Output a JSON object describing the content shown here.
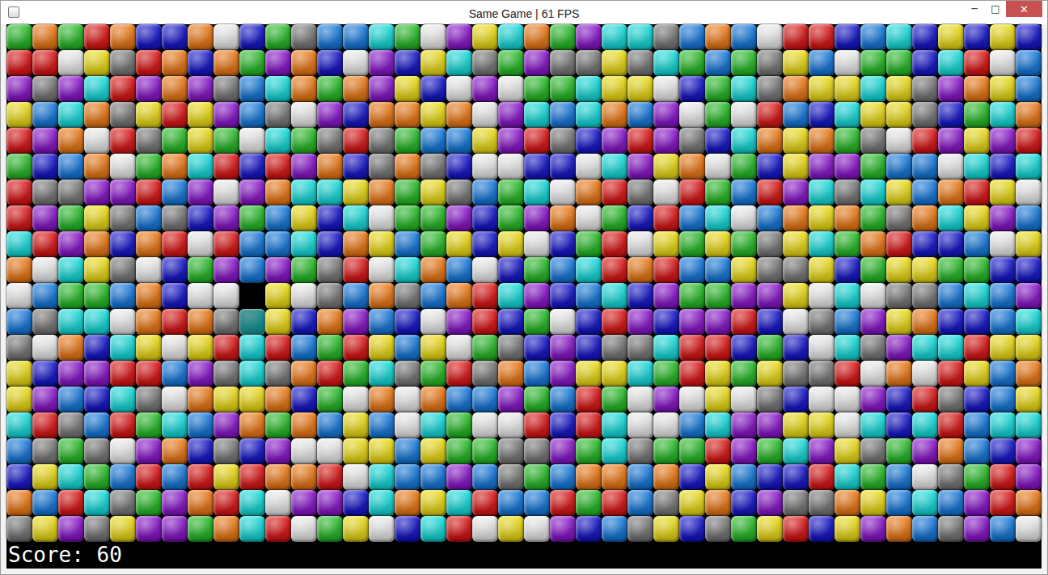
{
  "window": {
    "title": "Same Game | 61 FPS",
    "controls": [
      {
        "label": "─"
      },
      {
        "label": "□"
      },
      {
        "label": "✕"
      }
    ]
  },
  "board": {
    "rows": [
      [
        "#2b2",
        "#e71",
        "#2b2",
        "#d11",
        "#e71",
        "#11c",
        "#11c",
        "#e71",
        "#eee",
        "#11c",
        "#2b2",
        "#777",
        "#17d",
        "#17d",
        "#1dd",
        "#2b2",
        "#eee",
        "#81c",
        "#ed1",
        "#1dd",
        "#e71",
        "#2b2",
        "#81c",
        "#1dd",
        "#1dd",
        "#777",
        "#17d",
        "#e71",
        "#17d",
        "#eee",
        "#d11",
        "#d11",
        "#11c",
        "#17d",
        "#1dd",
        "#11c",
        "#ed1",
        "#11c",
        "#ed1",
        "#11c"
      ],
      [
        "#d11",
        "#d11",
        "#eee",
        "#ed1",
        "#777",
        "#d11",
        "#e71",
        "#11c",
        "#e71",
        "#2b2",
        "#81c",
        "#e71",
        "#11c",
        "#eee",
        "#81c",
        "#11c",
        "#ed1",
        "#1dd",
        "#777",
        "#2b2",
        "#81c",
        "#777",
        "#777",
        "#ed1",
        "#777",
        "#1dd",
        "#2b2",
        "#17d",
        "#2b2",
        "#777",
        "#ed1",
        "#17d",
        "#eee",
        "#2b2",
        "#2b2",
        "#11c",
        "#1dd",
        "#d11",
        "#eee",
        "#17d"
      ],
      [
        "#81c",
        "#777",
        "#81c",
        "#1dd",
        "#d11",
        "#81c",
        "#e71",
        "#81c",
        "#777",
        "#17d",
        "#1dd",
        "#e71",
        "#2b2",
        "#e71",
        "#81c",
        "#ed1",
        "#11c",
        "#eee",
        "#81c",
        "#eee",
        "#2b2",
        "#2b2",
        "#1dd",
        "#ed1",
        "#ed1",
        "#eee",
        "#11c",
        "#2b2",
        "#1dd",
        "#777",
        "#e71",
        "#ed1",
        "#ed1",
        "#1dd",
        "#ed1",
        "#777",
        "#81c",
        "#e71",
        "#ed1",
        "#17d"
      ],
      [
        "#ed1",
        "#17d",
        "#1dd",
        "#e71",
        "#777",
        "#ed1",
        "#d11",
        "#ed1",
        "#81c",
        "#17d",
        "#777",
        "#eee",
        "#81c",
        "#11c",
        "#e71",
        "#e71",
        "#ed1",
        "#e71",
        "#eee",
        "#81c",
        "#1dd",
        "#17d",
        "#1dd",
        "#e71",
        "#17d",
        "#81c",
        "#eee",
        "#2b2",
        "#eee",
        "#d11",
        "#17d",
        "#11c",
        "#1dd",
        "#ed1",
        "#ed1",
        "#777",
        "#11c",
        "#2b2",
        "#1dd",
        "#e71"
      ],
      [
        "#d11",
        "#81c",
        "#e71",
        "#eee",
        "#d11",
        "#777",
        "#2b2",
        "#ed1",
        "#2b2",
        "#eee",
        "#1dd",
        "#2b2",
        "#777",
        "#d11",
        "#777",
        "#2b2",
        "#17d",
        "#17d",
        "#ed1",
        "#81c",
        "#d11",
        "#777",
        "#11c",
        "#81c",
        "#d11",
        "#81c",
        "#777",
        "#11c",
        "#1dd",
        "#e71",
        "#ed1",
        "#e71",
        "#2b2",
        "#777",
        "#eee",
        "#d11",
        "#81c",
        "#ed1",
        "#81c",
        "#d11"
      ],
      [
        "#2b2",
        "#11c",
        "#17d",
        "#e71",
        "#eee",
        "#2b2",
        "#e71",
        "#1dd",
        "#d11",
        "#11c",
        "#d11",
        "#81c",
        "#e71",
        "#11c",
        "#777",
        "#e71",
        "#777",
        "#11c",
        "#eee",
        "#eee",
        "#11c",
        "#11c",
        "#eee",
        "#1dd",
        "#81c",
        "#ed1",
        "#e71",
        "#eee",
        "#2b2",
        "#11c",
        "#ed1",
        "#81c",
        "#81c",
        "#2b2",
        "#17d",
        "#17d",
        "#eee",
        "#1dd",
        "#11c",
        "#1dd"
      ],
      [
        "#d11",
        "#777",
        "#777",
        "#81c",
        "#81c",
        "#d11",
        "#17d",
        "#81c",
        "#eee",
        "#81c",
        "#e71",
        "#1dd",
        "#1dd",
        "#ed1",
        "#e71",
        "#2b2",
        "#ed1",
        "#777",
        "#17d",
        "#2b2",
        "#1dd",
        "#eee",
        "#e71",
        "#d11",
        "#777",
        "#eee",
        "#d11",
        "#2b2",
        "#17d",
        "#d11",
        "#81c",
        "#1dd",
        "#777",
        "#1dd",
        "#ed1",
        "#17d",
        "#e71",
        "#d11",
        "#ed1",
        "#eee"
      ],
      [
        "#d11",
        "#81c",
        "#2b2",
        "#ed1",
        "#777",
        "#17d",
        "#777",
        "#11c",
        "#81c",
        "#2b2",
        "#17d",
        "#ed1",
        "#11c",
        "#1dd",
        "#eee",
        "#2b2",
        "#2b2",
        "#81c",
        "#11c",
        "#2b2",
        "#81c",
        "#e71",
        "#eee",
        "#2b2",
        "#11c",
        "#d11",
        "#17d",
        "#1dd",
        "#eee",
        "#17d",
        "#e71",
        "#ed1",
        "#e71",
        "#2b2",
        "#777",
        "#e71",
        "#1dd",
        "#ed1",
        "#81c",
        "#17d"
      ],
      [
        "#1dd",
        "#d11",
        "#81c",
        "#e71",
        "#11c",
        "#e71",
        "#d11",
        "#eee",
        "#d11",
        "#17d",
        "#17d",
        "#1dd",
        "#11c",
        "#e71",
        "#ed1",
        "#17d",
        "#2b2",
        "#ed1",
        "#11c",
        "#ed1",
        "#eee",
        "#11c",
        "#2b2",
        "#d11",
        "#eee",
        "#ed1",
        "#2b2",
        "#ed1",
        "#2b2",
        "#777",
        "#ed1",
        "#1dd",
        "#2b2",
        "#e71",
        "#d11",
        "#11c",
        "#11c",
        "#17d",
        "#eee",
        "#ed1"
      ],
      [
        "#e71",
        "#eee",
        "#1dd",
        "#ed1",
        "#777",
        "#eee",
        "#11c",
        "#2b2",
        "#81c",
        "#17d",
        "#81c",
        "#2b2",
        "#777",
        "#d11",
        "#eee",
        "#1dd",
        "#e71",
        "#17d",
        "#eee",
        "#11c",
        "#2b2",
        "#17d",
        "#1dd",
        "#d11",
        "#e71",
        "#d11",
        "#17d",
        "#17d",
        "#ed1",
        "#777",
        "#777",
        "#ed1",
        "#11c",
        "#2b2",
        "#ed1",
        "#ed1",
        "#2b2",
        "#2b2",
        "#11c",
        "#11c"
      ],
      [
        "#eee",
        "#17d",
        "#2b2",
        "#2b2",
        "#17d",
        "#e71",
        "#11c",
        "#eee",
        "#eee",
        null,
        "#ed1",
        "#eee",
        "#777",
        "#17d",
        "#e71",
        "#777",
        "#17d",
        "#e71",
        "#d11",
        "#1dd",
        "#81c",
        "#11c",
        "#17d",
        "#1dd",
        "#11c",
        "#81c",
        "#2b2",
        "#2b2",
        "#81c",
        "#81c",
        "#ed1",
        "#eee",
        "#1dd",
        "#eee",
        "#777",
        "#777",
        "#17d",
        "#1dd",
        "#17d",
        "#81c"
      ],
      [
        "#17d",
        "#777",
        "#1dd",
        "#1dd",
        "#eee",
        "#e71",
        "#d11",
        "#e71",
        "#777",
        {
          "color": "#1dd",
          "selected": true
        },
        "#ed1",
        "#11c",
        "#e71",
        "#81c",
        "#17d",
        "#11c",
        "#eee",
        "#81c",
        "#d11",
        "#11c",
        "#2b2",
        "#eee",
        "#11c",
        "#d11",
        "#81c",
        "#11c",
        "#81c",
        "#81c",
        "#d11",
        "#11c",
        "#eee",
        "#777",
        "#17d",
        "#81c",
        "#ed1",
        "#e71",
        "#11c",
        "#11c",
        "#17d",
        "#1dd"
      ],
      [
        "#777",
        "#eee",
        "#e71",
        "#11c",
        "#1dd",
        "#ed1",
        "#eee",
        "#ed1",
        "#d11",
        "#1dd",
        "#d11",
        "#17d",
        "#2b2",
        "#d11",
        "#ed1",
        "#17d",
        "#ed1",
        "#eee",
        "#2b2",
        "#777",
        "#11c",
        "#81c",
        "#11c",
        "#777",
        "#777",
        "#1dd",
        "#d11",
        "#d11",
        "#11c",
        "#2b2",
        "#11c",
        "#eee",
        "#1dd",
        "#777",
        "#81c",
        "#1dd",
        "#1dd",
        "#d11",
        "#ed1",
        "#ed1"
      ],
      [
        "#ed1",
        "#11c",
        "#81c",
        "#81c",
        "#d11",
        "#d11",
        "#17d",
        "#81c",
        "#777",
        "#1dd",
        "#777",
        "#e71",
        "#d11",
        "#2b2",
        "#1dd",
        "#777",
        "#2b2",
        "#d11",
        "#777",
        "#e71",
        "#17d",
        "#81c",
        "#ed1",
        "#ed1",
        "#1dd",
        "#2b2",
        "#d11",
        "#ed1",
        "#2b2",
        "#ed1",
        "#777",
        "#777",
        "#d11",
        "#eee",
        "#e71",
        "#eee",
        "#d11",
        "#ed1",
        "#17d",
        "#e71"
      ],
      [
        "#ed1",
        "#81c",
        "#17d",
        "#11c",
        "#1dd",
        "#777",
        "#eee",
        "#e71",
        "#ed1",
        "#ed1",
        "#e71",
        "#11c",
        "#2b2",
        "#eee",
        "#e71",
        "#eee",
        "#e71",
        "#17d",
        "#17d",
        "#81c",
        "#2b2",
        "#17d",
        "#d11",
        "#2b2",
        "#eee",
        "#81c",
        "#eee",
        "#ed1",
        "#eee",
        "#777",
        "#11c",
        "#eee",
        "#eee",
        "#81c",
        "#11c",
        "#d11",
        "#777",
        "#11c",
        "#17d",
        "#ed1"
      ],
      [
        "#1dd",
        "#d11",
        "#777",
        "#17d",
        "#d11",
        "#2b2",
        "#1dd",
        "#17d",
        "#81c",
        "#e71",
        "#2b2",
        "#e71",
        "#17d",
        "#ed1",
        "#17d",
        "#eee",
        "#1dd",
        "#2b2",
        "#eee",
        "#eee",
        "#d11",
        "#11c",
        "#d11",
        "#1dd",
        "#eee",
        "#eee",
        "#17d",
        "#1dd",
        "#81c",
        "#81c",
        "#ed1",
        "#ed1",
        "#eee",
        "#1dd",
        "#11c",
        "#1dd",
        "#d11",
        "#17d",
        "#1dd",
        "#1dd"
      ],
      [
        "#17d",
        "#777",
        "#2b2",
        "#777",
        "#eee",
        "#81c",
        "#e71",
        "#11c",
        "#777",
        "#11c",
        "#81c",
        "#eee",
        "#eee",
        "#ed1",
        "#ed1",
        "#17d",
        "#ed1",
        "#2b2",
        "#2b2",
        "#777",
        "#777",
        "#81c",
        "#2b2",
        "#1dd",
        "#777",
        "#2b2",
        "#2b2",
        "#d11",
        "#81c",
        "#2b2",
        "#1dd",
        "#81c",
        "#ed1",
        "#777",
        "#2b2",
        "#81c",
        "#e71",
        "#17d",
        "#11c",
        "#81c"
      ],
      [
        "#11c",
        "#ed1",
        "#1dd",
        "#2b2",
        "#17d",
        "#d11",
        "#17d",
        "#d11",
        "#ed1",
        "#d11",
        "#e71",
        "#e71",
        "#d11",
        "#eee",
        "#1dd",
        "#17d",
        "#17d",
        "#81c",
        "#17d",
        "#777",
        "#2b2",
        "#17d",
        "#e71",
        "#e71",
        "#17d",
        "#e71",
        "#11c",
        "#ed1",
        "#17d",
        "#11c",
        "#11c",
        "#d11",
        "#1dd",
        "#2b2",
        "#17d",
        "#eee",
        "#777",
        "#2b2",
        "#d11",
        "#81c"
      ],
      [
        "#e71",
        "#17d",
        "#d11",
        "#1dd",
        "#777",
        "#2b2",
        "#81c",
        "#e71",
        "#d11",
        "#1dd",
        "#eee",
        "#81c",
        "#81c",
        "#11c",
        "#1dd",
        "#e71",
        "#ed1",
        "#1dd",
        "#d11",
        "#17d",
        "#17d",
        "#d11",
        "#2b2",
        "#d11",
        "#17d",
        "#777",
        "#ed1",
        "#e71",
        "#11c",
        "#81c",
        "#777",
        "#777",
        "#e71",
        "#ed1",
        "#17d",
        "#1dd",
        "#17d",
        "#81c",
        "#d11",
        "#e71"
      ],
      [
        "#777",
        "#ed1",
        "#81c",
        "#777",
        "#ed1",
        "#81c",
        "#81c",
        "#2b2",
        "#e71",
        "#1dd",
        "#d11",
        "#eee",
        "#2b2",
        "#ed1",
        "#eee",
        "#11c",
        "#1dd",
        "#d11",
        "#eee",
        "#ed1",
        "#eee",
        "#81c",
        "#11c",
        "#17d",
        "#777",
        "#ed1",
        "#11c",
        "#777",
        "#2b2",
        "#ed1",
        "#d11",
        "#11c",
        "#ed1",
        "#81c",
        "#e71",
        "#17d",
        "#777",
        "#81c",
        "#17d",
        "#eee"
      ]
    ]
  },
  "score": "Score: 60"
}
